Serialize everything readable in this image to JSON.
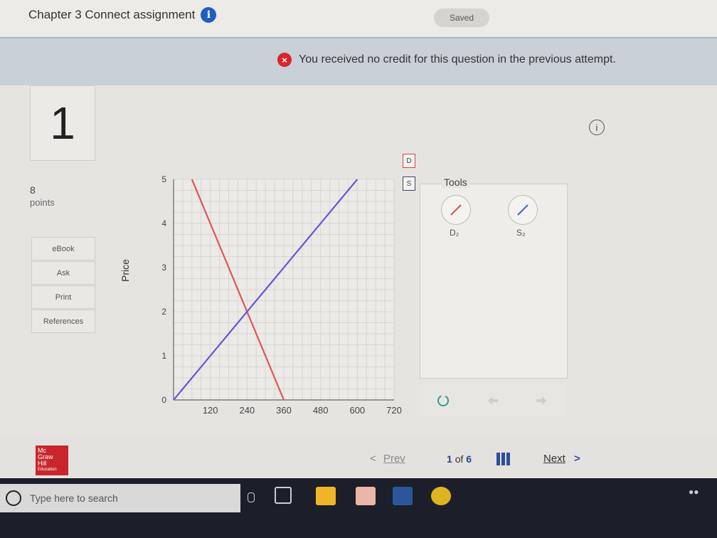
{
  "header": {
    "title": "Chapter 3 Connect assignment",
    "info_glyph": "i",
    "status": "Saved"
  },
  "alert": {
    "icon_glyph": "×",
    "message": "You received no credit for this question in the previous attempt."
  },
  "question": {
    "number": "1",
    "points_value": "8",
    "points_label": "points"
  },
  "side_menu": [
    "eBook",
    "Ask",
    "Print",
    "References"
  ],
  "info_glyph": "i",
  "graph_tags": {
    "d": "D",
    "s": "S"
  },
  "tools": {
    "title": "Tools",
    "items": [
      {
        "label": "D₂",
        "color": "#e04a4a"
      },
      {
        "label": "S₂",
        "color": "#4466cc"
      }
    ]
  },
  "chart_data": {
    "type": "line",
    "ylabel": "Price",
    "xlabel": "",
    "xlim": [
      0,
      720
    ],
    "ylim": [
      0,
      5
    ],
    "x_ticks": [
      "120",
      "240",
      "360",
      "480",
      "600",
      "720"
    ],
    "y_ticks": [
      "0",
      "1",
      "2",
      "3",
      "4",
      "5"
    ],
    "grid": true,
    "series": [
      {
        "color": "#e05555",
        "points": [
          [
            60,
            5
          ],
          [
            360,
            0
          ]
        ]
      },
      {
        "color": "#6655dd",
        "points": [
          [
            0,
            0
          ],
          [
            600,
            5
          ]
        ]
      }
    ]
  },
  "footer": {
    "logo_lines": [
      "Mc",
      "Graw",
      "Hill",
      "Education"
    ],
    "prev_label": "Prev",
    "page_current": "1",
    "page_of": "of",
    "page_total": "6",
    "next_label": "Next",
    "prev_arrow": "<",
    "next_arrow": ">"
  },
  "taskbar": {
    "search_placeholder": "Type here to search"
  }
}
